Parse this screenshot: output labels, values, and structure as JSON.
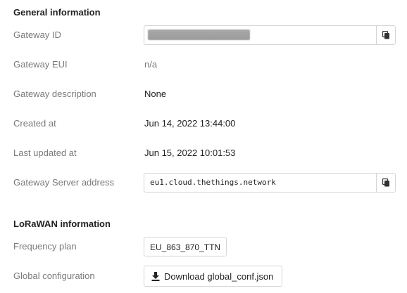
{
  "general": {
    "title": "General information",
    "gateway_id": {
      "label": "Gateway ID",
      "value": ""
    },
    "gateway_eui": {
      "label": "Gateway EUI",
      "value": "n/a"
    },
    "gateway_description": {
      "label": "Gateway description",
      "value": "None"
    },
    "created_at": {
      "label": "Created at",
      "value": "Jun 14, 2022 13:44:00"
    },
    "last_updated_at": {
      "label": "Last updated at",
      "value": "Jun 15, 2022 10:01:53"
    },
    "gateway_server_address": {
      "label": "Gateway Server address",
      "value": "eu1.cloud.thethings.network"
    }
  },
  "lorawan": {
    "title": "LoRaWAN information",
    "frequency_plan": {
      "label": "Frequency plan",
      "value": "EU_863_870_TTN"
    },
    "global_configuration": {
      "label": "Global configuration",
      "button_label": "Download global_conf.json"
    }
  },
  "icons": {
    "copy": "copy-icon",
    "download": "download-icon"
  },
  "colors": {
    "label": "#7a7a7a",
    "text": "#222222",
    "border": "#d5d5d5"
  }
}
